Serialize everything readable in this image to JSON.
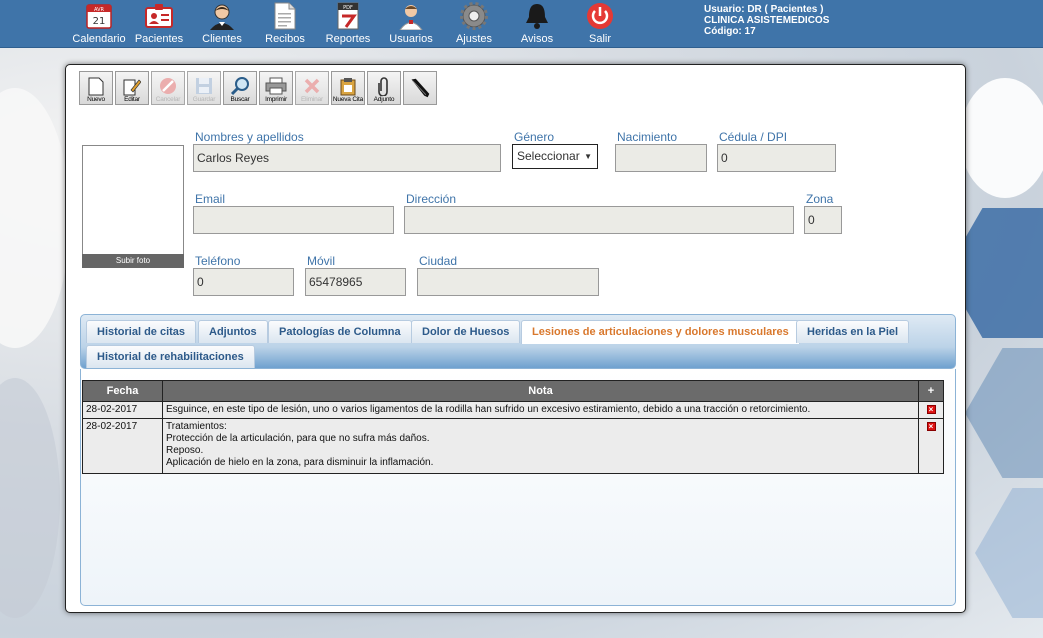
{
  "nav": {
    "items": [
      {
        "label": "Calendario",
        "icon": "calendar-icon"
      },
      {
        "label": "Pacientes",
        "icon": "patient-card-icon"
      },
      {
        "label": "Clientes",
        "icon": "client-person-icon"
      },
      {
        "label": "Recibos",
        "icon": "receipt-icon"
      },
      {
        "label": "Reportes",
        "icon": "report-pdf-icon"
      },
      {
        "label": "Usuarios",
        "icon": "users-doctor-icon"
      },
      {
        "label": "Ajustes",
        "icon": "gear-icon"
      },
      {
        "label": "Avisos",
        "icon": "bell-icon"
      },
      {
        "label": "Salir",
        "icon": "power-icon"
      }
    ],
    "calendar_month": "AVR",
    "calendar_day": "21"
  },
  "user": {
    "line1": "Usuario: DR   ( Pacientes )",
    "line2": "CLINICA ASISTEMEDICOS",
    "line3": "Código: 17"
  },
  "toolbar": {
    "nuevo": "Nuevo",
    "editar": "Editar",
    "cancelar": "Cancelar",
    "guardar": "Guardar",
    "buscar": "Buscar",
    "imprimir": "Imprimir",
    "eliminar": "Eliminar",
    "nueva_cita": "Nueva Cita",
    "adjunto": "Adjunto"
  },
  "photo": {
    "upload_label": "Subir foto"
  },
  "form": {
    "nombres_label": "Nombres y apellidos",
    "nombres_value": "Carlos Reyes",
    "genero_label": "Género",
    "genero_value": "Seleccionar",
    "nacimiento_label": "Nacimiento",
    "nacimiento_value": "",
    "cedula_label": "Cédula / DPI",
    "cedula_value": "0",
    "email_label": "Email",
    "email_value": "",
    "direccion_label": "Dirección",
    "direccion_value": "",
    "zona_label": "Zona",
    "zona_value": "0",
    "telefono_label": "Teléfono",
    "telefono_value": "0",
    "movil_label": "Móvil",
    "movil_value": "65478965",
    "ciudad_label": "Ciudad",
    "ciudad_value": ""
  },
  "tabs": [
    {
      "label": "Historial de citas"
    },
    {
      "label": "Adjuntos"
    },
    {
      "label": "Patologías de Columna"
    },
    {
      "label": "Dolor de Huesos"
    },
    {
      "label": "Lesiones de articulaciones y dolores musculares"
    },
    {
      "label": "Heridas en la Piel"
    },
    {
      "label": "Historial de rehabilitaciones"
    }
  ],
  "active_tab": "Lesiones de articulaciones y dolores musculares",
  "table": {
    "col_fecha": "Fecha",
    "col_nota": "Nota",
    "col_add": "+",
    "rows": [
      {
        "fecha": "28-02-2017",
        "nota_lines": [
          "Esguince, en este tipo de lesión, uno o varios ligamentos de la rodilla han sufrido un excesivo estiramiento, debido a una tracción o retorcimiento."
        ]
      },
      {
        "fecha": "28-02-2017",
        "nota_lines": [
          "Tratamientos:",
          "Protección de la articulación, para que no sufra más daños.",
          "Reposo.",
          "Aplicación de hielo en la zona, para disminuir la inflamación."
        ]
      }
    ],
    "delete_glyph": "×"
  },
  "colors": {
    "nav_bg": "#3f74a9",
    "label_blue": "#3f74a9",
    "active_tab": "#d9782d",
    "header_gray": "#6b6b6b"
  }
}
